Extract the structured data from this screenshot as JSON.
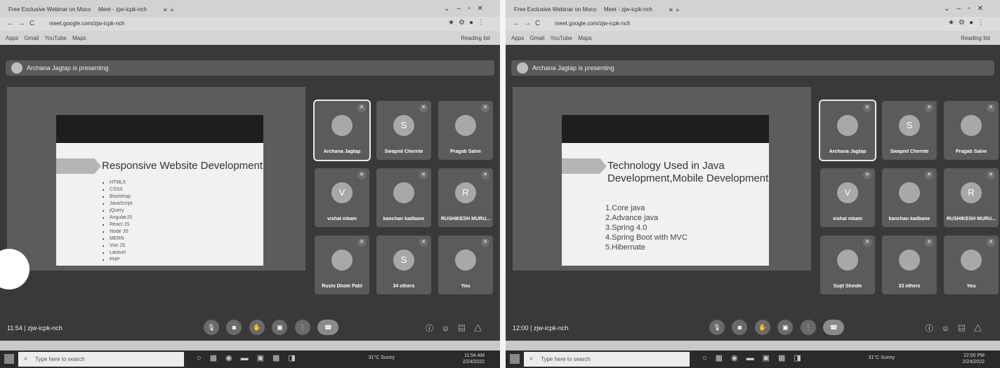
{
  "screenshots": [
    {
      "tabs": [
        "Free Exclusive Webinar on Moco",
        "Meet - zjw-icpk-nch"
      ],
      "url": "meet.google.com/zjw-icpk-nch",
      "bookmarks": "Apps  Gmail  YouTube  Maps",
      "reading_list": "Reading list",
      "presenter_banner": "Archana Jagtap is presenting",
      "slide": {
        "title": "Responsive Website Development",
        "bullets": [
          "HTML5",
          "CSS3",
          "Bootstrap",
          "JavaScript",
          "jQuery",
          "AngularJS",
          "React JS",
          "Node JS",
          "MERN",
          "Vue JS",
          "Laravel",
          "PHP"
        ],
        "list": []
      },
      "tiles": [
        {
          "name": "Archana Jagtap",
          "initial": "",
          "active": true
        },
        {
          "name": "Swapnil Chernte",
          "initial": "S",
          "active": false
        },
        {
          "name": "Pragati Salve",
          "initial": "",
          "active": false
        },
        {
          "name": "vishal nikam",
          "initial": "V",
          "active": false
        },
        {
          "name": "kanchan kadbane",
          "initial": "",
          "active": false
        },
        {
          "name": "RUSHIKESH MURU...",
          "initial": "R",
          "active": false
        },
        {
          "name": "Rushi Dhole Patil",
          "initial": "",
          "active": false
        },
        {
          "name": "34 others",
          "initial": "S",
          "active": false
        },
        {
          "name": "You",
          "initial": "",
          "active": false
        }
      ],
      "clock": "11:54  |  zjw-icpk-nch",
      "taskbar": {
        "search_placeholder": "Type here to search",
        "weather": "31°C Sunny",
        "time": "11:54 AM",
        "date": "2/24/2022"
      }
    },
    {
      "tabs": [
        "Free Exclusive Webinar on Moco",
        "Meet - zjw-icpk-nch"
      ],
      "url": "meet.google.com/zjw-icpk-nch",
      "bookmarks": "Apps  Gmail  YouTube  Maps",
      "reading_list": "Reading list",
      "presenter_banner": "Archana Jagtap is presenting",
      "slide": {
        "title": "Technology Used in Java Development,Mobile Development",
        "bullets": [],
        "list": [
          "1.Core java",
          "2.Advance java",
          "3.Spring 4.0",
          "4.Spring Boot with MVC",
          "5.Hibernate"
        ]
      },
      "tiles": [
        {
          "name": "Archana Jagtap",
          "initial": "",
          "active": true
        },
        {
          "name": "Swapnil Chernte",
          "initial": "S",
          "active": false
        },
        {
          "name": "Pragati Salve",
          "initial": "",
          "active": false
        },
        {
          "name": "vishal nikam",
          "initial": "V",
          "active": false
        },
        {
          "name": "kanchan kadbane",
          "initial": "",
          "active": false
        },
        {
          "name": "RUSHIKESH MURU...",
          "initial": "R",
          "active": false
        },
        {
          "name": "Sujit Shinde",
          "initial": "",
          "active": false
        },
        {
          "name": "33 others",
          "initial": "",
          "active": false
        },
        {
          "name": "You",
          "initial": "",
          "active": false
        }
      ],
      "clock": "12:00  |  zjw-icpk-nch",
      "taskbar": {
        "search_placeholder": "Type here to search",
        "weather": "31°C Sunny",
        "time": "12:00 PM",
        "date": "2/24/2022"
      }
    }
  ]
}
